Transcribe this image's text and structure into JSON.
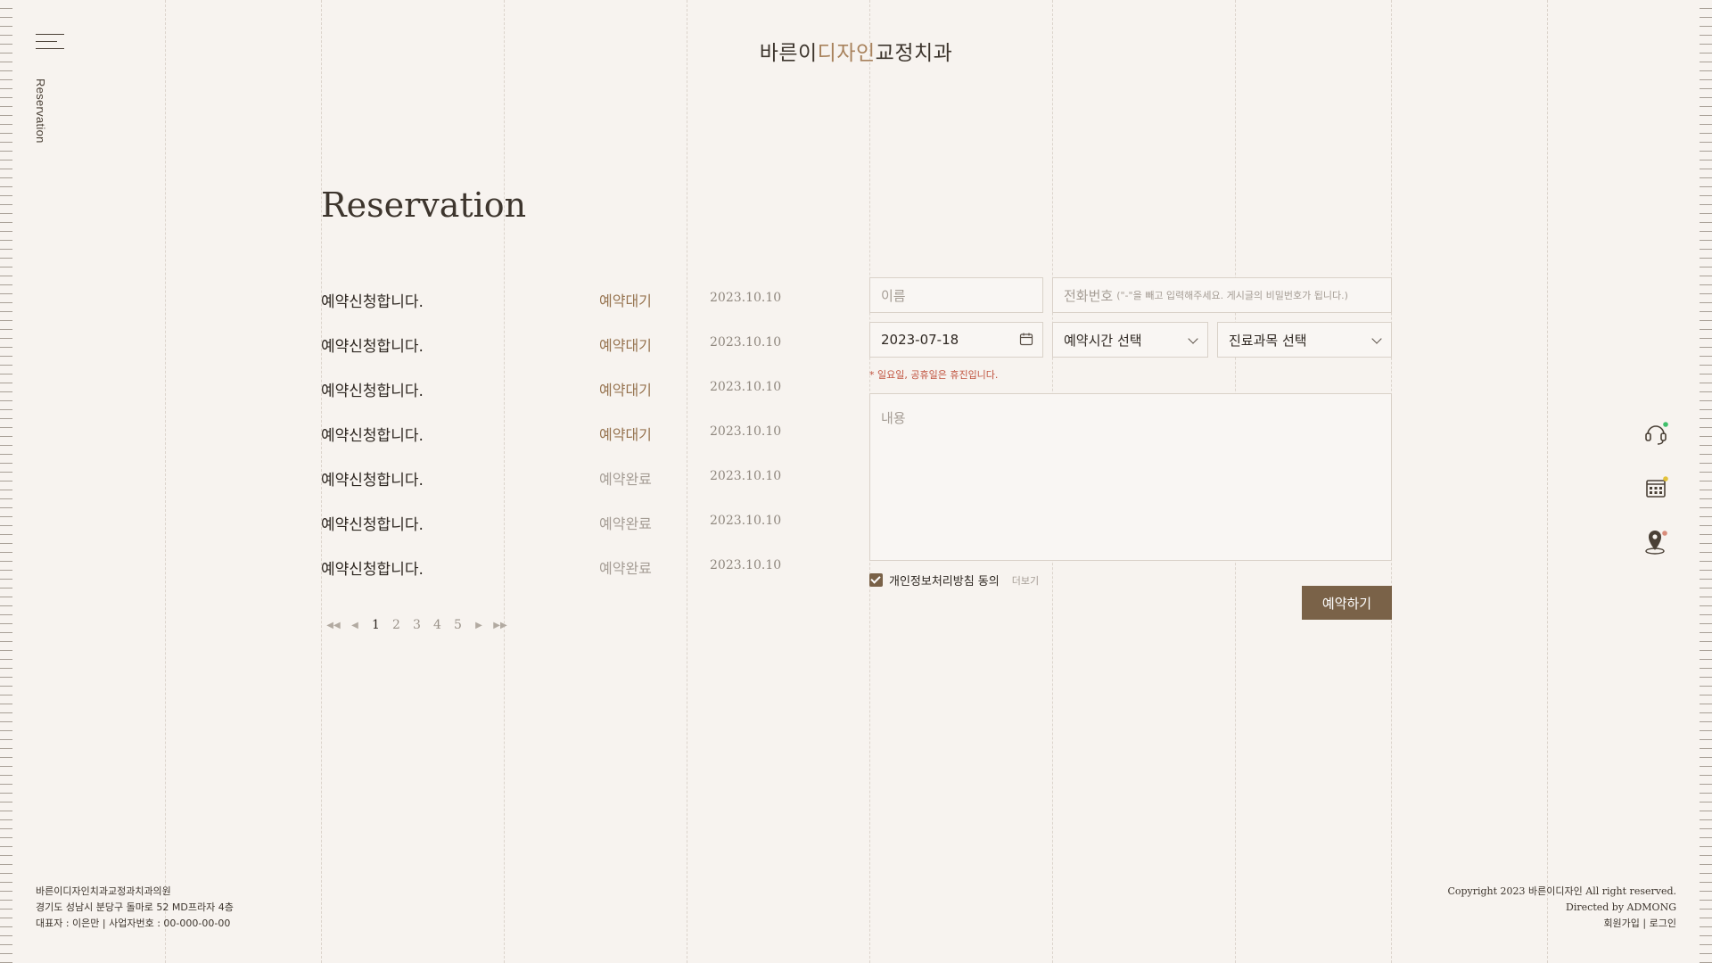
{
  "header": {
    "logo_pre": "바른이",
    "logo_accent": "디자인",
    "logo_post": "교정치과",
    "side_label": "Reservation"
  },
  "page": {
    "title": "Reservation"
  },
  "list": [
    {
      "title": "예약신청합니다.",
      "status": "예약대기",
      "date": "2023.10.10"
    },
    {
      "title": "예약신청합니다.",
      "status": "예약대기",
      "date": "2023.10.10"
    },
    {
      "title": "예약신청합니다.",
      "status": "예약대기",
      "date": "2023.10.10"
    },
    {
      "title": "예약신청합니다.",
      "status": "예약대기",
      "date": "2023.10.10"
    },
    {
      "title": "예약신청합니다.",
      "status": "예약완료",
      "date": "2023.10.10"
    },
    {
      "title": "예약신청합니다.",
      "status": "예약완료",
      "date": "2023.10.10"
    },
    {
      "title": "예약신청합니다.",
      "status": "예약완료",
      "date": "2023.10.10"
    }
  ],
  "pagination": {
    "pages": [
      "1",
      "2",
      "3",
      "4",
      "5"
    ],
    "current": "1"
  },
  "form": {
    "name_placeholder": "이름",
    "phone_placeholder": "전화번호",
    "phone_hint": "(\"-\"을 빼고 입력해주세요. 게시글의 비밀번호가 됩니다.)",
    "date_value": "2023-07-18",
    "time_select": "예약시간 선택",
    "dept_select": "진료과목 선택",
    "notice": "* 일요일, 공휴일은 휴진입니다.",
    "memo_placeholder": "내용",
    "agree_label": "개인정보처리방침 동의",
    "more_label": "더보기",
    "submit_label": "예약하기"
  },
  "quick_menu": [
    "headset-icon",
    "calendar-icon",
    "location-icon"
  ],
  "footer": {
    "left": [
      "바른이디자인치과교정과치과의원",
      "경기도 성남시 분당구 돌마로 52 MD프라자 4층",
      "대표자 : 이은만 | 사업자번호 : 00-000-00-00"
    ],
    "copyright": "Copyright 2023 바른이디자인 All right reserved.",
    "directed": "Directed by ADMONG",
    "join": "회원가입",
    "login": "로그인"
  },
  "colors": {
    "background": "#f7f3ef",
    "accent": "#a8825c",
    "button": "#7a6248",
    "status_wait": "#96734f",
    "status_done": "#a59d95",
    "notice": "#c0533f"
  }
}
